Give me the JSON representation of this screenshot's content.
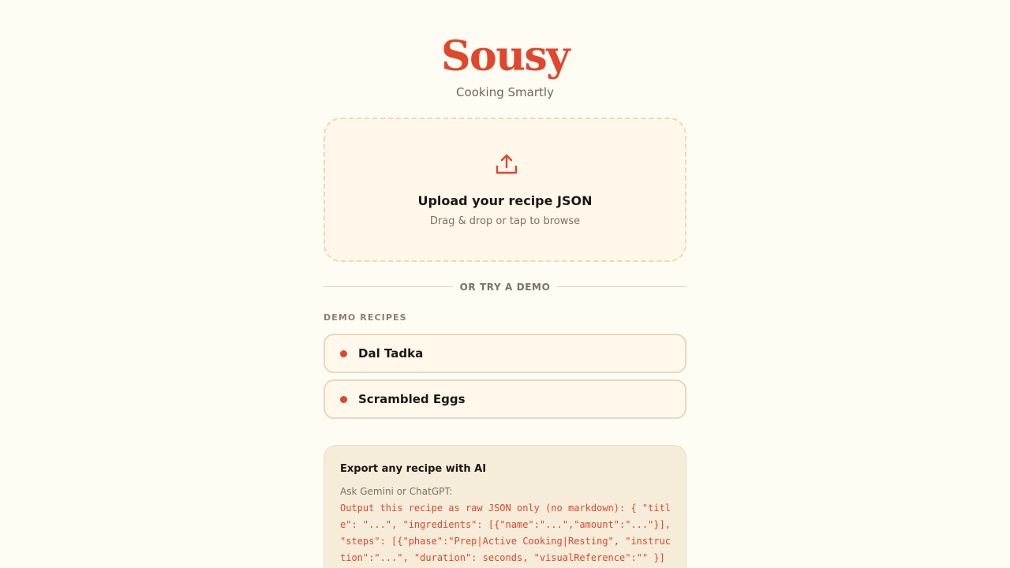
{
  "brand": {
    "name": "Sousy",
    "tagline": "Cooking Smartly"
  },
  "upload": {
    "icon": "upload-icon",
    "title": "Upload your recipe JSON",
    "subtitle": "Drag & drop or tap to browse"
  },
  "divider": {
    "text": "OR TRY A DEMO"
  },
  "demo": {
    "label": "DEMO RECIPES",
    "recipes": [
      {
        "name": "Dal Tadka"
      },
      {
        "name": "Scrambled Eggs"
      }
    ]
  },
  "export": {
    "title": "Export any recipe with AI",
    "ask": "Ask Gemini or ChatGPT:",
    "prompt": "Output this recipe as raw JSON only (no markdown): { \"title\": \"...\", \"ingredients\": [{\"name\":\"...\",\"amount\":\"...\"}], \"steps\": [{\"phase\":\"Prep|Active Cooking|Resting\", \"instruction\":\"...\", \"duration\": seconds, \"visualReference\":\"\" }]"
  },
  "colors": {
    "accent": "#e0472d",
    "background": "#fffcf3",
    "card": "#fff8eb",
    "export_bg": "#f5ecd9"
  }
}
